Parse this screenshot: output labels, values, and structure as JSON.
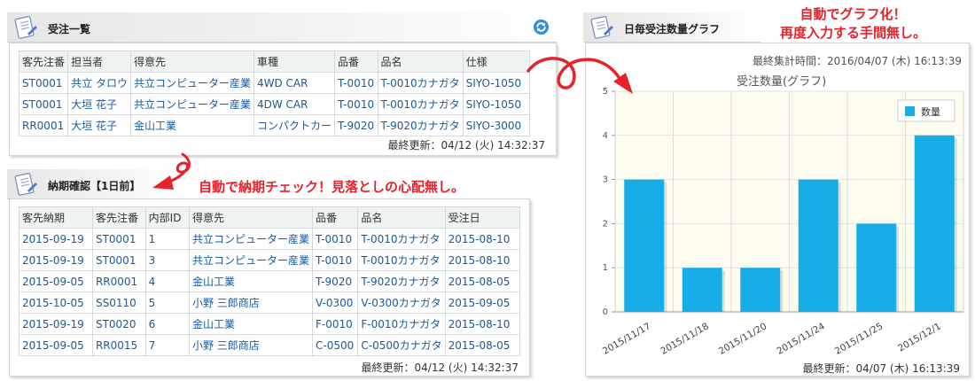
{
  "orders": {
    "title": "受注一覧",
    "refresh_icon": "refresh-icon",
    "headers": [
      "客先注番",
      "担当者",
      "得意先",
      "車種",
      "品番",
      "品名",
      "仕様"
    ],
    "rows": [
      [
        "ST0001",
        "共立 タロウ",
        "共立コンピューター産業",
        "4WD CAR",
        "T-0010",
        "T-0010カナガタ",
        "SIYO-1050"
      ],
      [
        "ST0001",
        "大垣 花子",
        "共立コンピューター産業",
        "4DW CAR",
        "T-0010",
        "T-0010カナガタ",
        "SIYO-1050"
      ],
      [
        "RR0001",
        "大垣 花子",
        "金山工業",
        "コンパクトカー",
        "T-9020",
        "T-9020カナガタ",
        "SIYO-3000"
      ]
    ],
    "updated": "最終更新：04/12 (火) 14:32:37"
  },
  "delivery": {
    "title": "納期確認【1日前】",
    "headers": [
      "客先納期",
      "客先注番",
      "内部ID",
      "得意先",
      "品番",
      "品名",
      "受注日"
    ],
    "rows": [
      [
        "2015-09-19",
        "ST0001",
        "1",
        "共立コンピューター産業",
        "T-0010",
        "T-0010カナガタ",
        "2015-08-10"
      ],
      [
        "2015-09-19",
        "ST0001",
        "3",
        "共立コンピューター産業",
        "T-0010",
        "T-0010カナガタ",
        "2015-08-10"
      ],
      [
        "2015-09-05",
        "RR0001",
        "4",
        "金山工業",
        "T-9020",
        "T-9020カナガタ",
        "2015-08-05"
      ],
      [
        "2015-10-05",
        "SS0110",
        "5",
        "小野 三郎商店",
        "V-0300",
        "V-0300カナガタ",
        "2015-09-05"
      ],
      [
        "2015-09-19",
        "ST0020",
        "6",
        "金山工業",
        "F-0010",
        "F-0010カナガタ",
        "2015-08-10"
      ],
      [
        "2015-09-05",
        "RR0015",
        "7",
        "小野 三郎商店",
        "C-0500",
        "C-0500カナガタ",
        "2015-08-05"
      ]
    ],
    "updated": "最終更新：04/12 (火) 14:32:37"
  },
  "daily_chart": {
    "title": "日毎受注数量グラフ",
    "aggregated": "最終集計時間：2016/04/07 (木) 16:13:39",
    "updated": "最終更新：04/07 (木) 16:13:39"
  },
  "callouts": {
    "chart_line1": "自動でグラフ化！",
    "chart_line2": "再度入力する手間無し。",
    "delivery": "自動で納期チェック！見落としの心配無し。"
  },
  "colors": {
    "accent_red": "#e8212a",
    "bar": "#17aee8",
    "plot_bg": "#fdfcef",
    "link": "#1a5aa0"
  },
  "icons": [
    "document-icon",
    "refresh-icon",
    "curved-arrow-icon"
  ],
  "chart_data": {
    "type": "bar",
    "title": "受注数量(グラフ)",
    "categories": [
      "2015/11/17",
      "2015/11/18",
      "2015/11/20",
      "2015/11/24",
      "2015/11/25",
      "2015/12/1"
    ],
    "series": [
      {
        "name": "数量",
        "values": [
          3,
          1,
          1,
          3,
          2,
          4
        ]
      }
    ],
    "ylim": [
      0,
      5
    ],
    "yticks": [
      0,
      1,
      2,
      3,
      4,
      5
    ],
    "grid": true,
    "legend": "top-right",
    "xlabel": "",
    "ylabel": ""
  }
}
